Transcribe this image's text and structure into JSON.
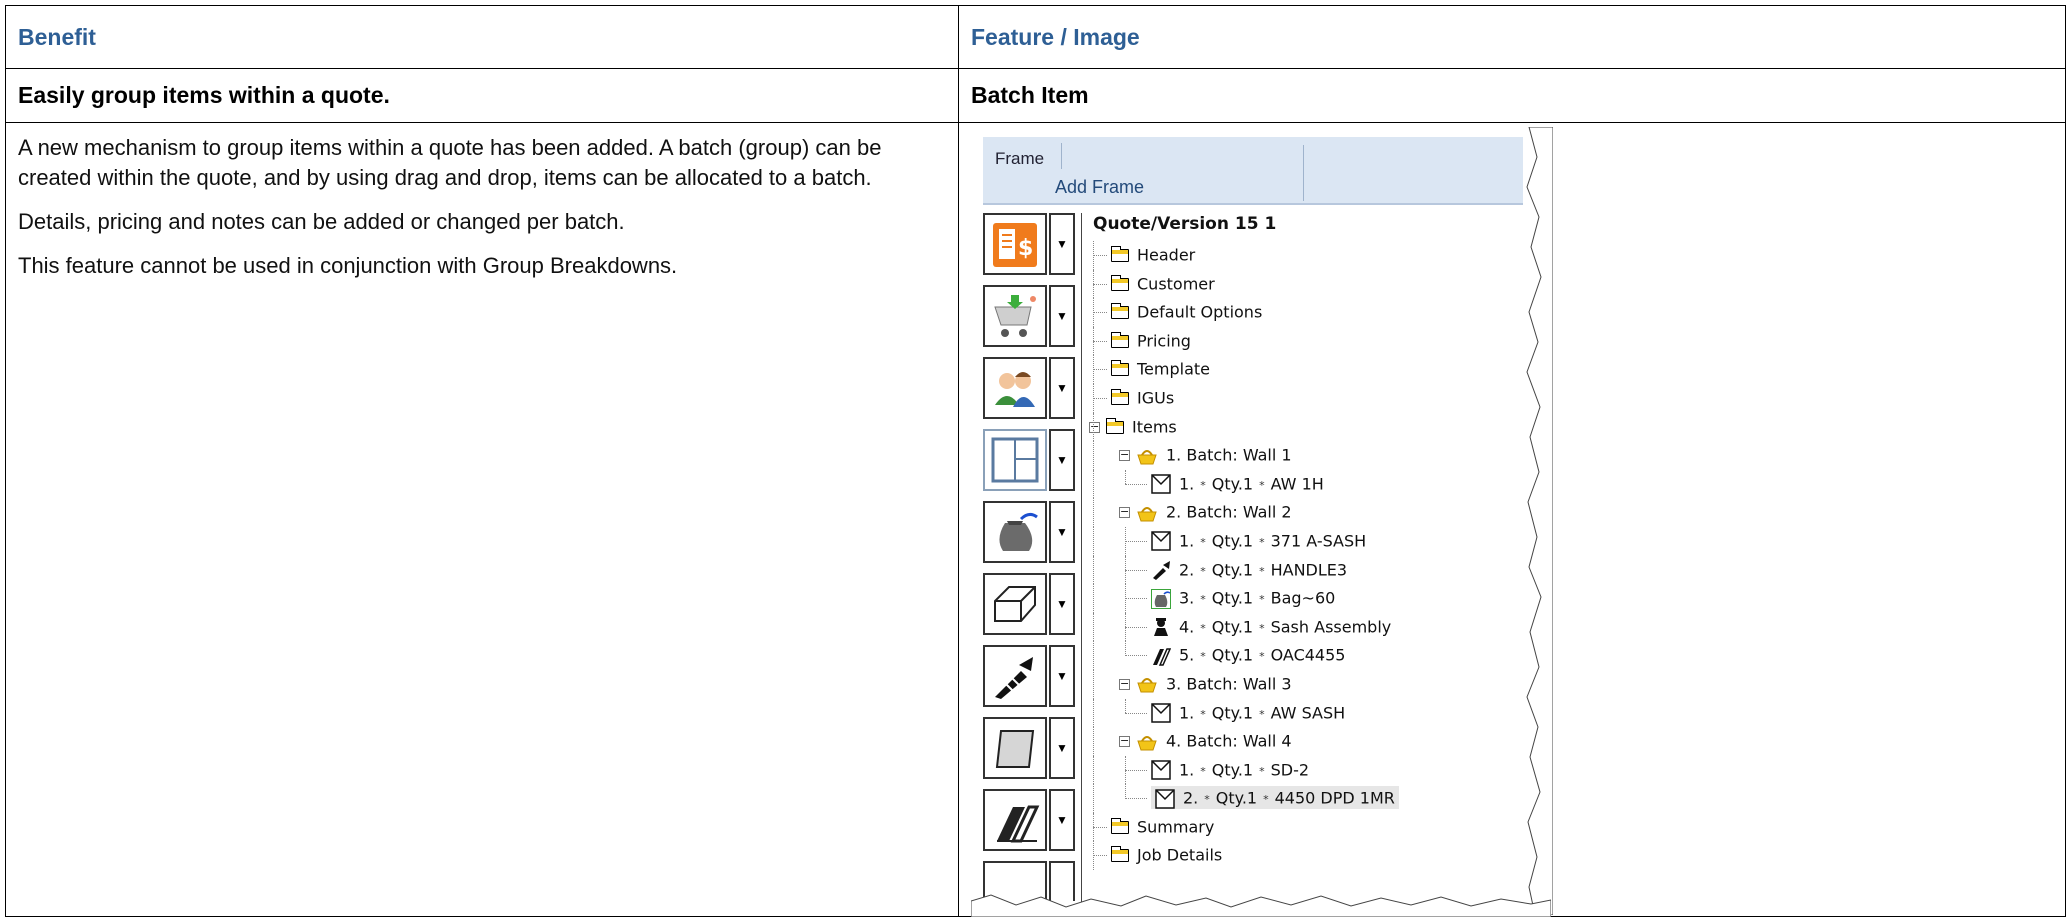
{
  "table": {
    "header_left": "Benefit",
    "header_right": "Feature / Image",
    "benefit_title": "Easily group items within a quote.",
    "feature_title": "Batch Item",
    "paragraphs": [
      "A new mechanism to group items within a quote has been added. A batch (group) can be created within the quote, and by using drag and drop, items can be allocated to a batch.",
      "Details, pricing and notes can be added or changed per batch.",
      "This feature cannot be used in conjunction with Group Breakdowns."
    ]
  },
  "screenshot": {
    "ribbon": {
      "frame_label": "Frame",
      "add_frame_label": "Add Frame"
    },
    "tools": [
      "quote-dollar-icon",
      "cart-icon",
      "users-icon",
      "window-frame-icon",
      "bag-icon",
      "profile-icon",
      "screw-icon",
      "glass-pane-icon",
      "extrusion-icon"
    ],
    "tree": {
      "root": "Quote/Version 15 1",
      "folders_top": [
        "Header",
        "Customer",
        "Default Options",
        "Pricing",
        "Template",
        "IGUs",
        "Items"
      ],
      "batches": [
        {
          "label": "1. Batch: Wall 1",
          "items": [
            {
              "no": "1.",
              "qty": "Qty.1",
              "name": "AW 1H",
              "icon": "frame-icon"
            }
          ]
        },
        {
          "label": "2. Batch: Wall 2",
          "items": [
            {
              "no": "1.",
              "qty": "Qty.1",
              "name": "371 A-SASH",
              "icon": "frame-icon"
            },
            {
              "no": "2.",
              "qty": "Qty.1",
              "name": "HANDLE3",
              "icon": "screw-icon"
            },
            {
              "no": "3.",
              "qty": "Qty.1",
              "name": "Bag~60",
              "icon": "bag-icon"
            },
            {
              "no": "4.",
              "qty": "Qty.1",
              "name": "Sash Assembly",
              "icon": "worker-icon"
            },
            {
              "no": "5.",
              "qty": "Qty.1",
              "name": "OAC4455",
              "icon": "extrusion-icon"
            }
          ]
        },
        {
          "label": "3. Batch: Wall 3",
          "items": [
            {
              "no": "1.",
              "qty": "Qty.1",
              "name": "AW SASH",
              "icon": "frame-icon"
            }
          ]
        },
        {
          "label": "4. Batch: Wall 4",
          "items": [
            {
              "no": "1.",
              "qty": "Qty.1",
              "name": "SD-2",
              "icon": "frame-icon"
            },
            {
              "no": "2.",
              "qty": "Qty.1",
              "name": "4450 DPD 1MR",
              "icon": "frame-icon"
            }
          ]
        }
      ],
      "folders_bottom": [
        "Summary",
        "Job Details"
      ]
    },
    "star": "*"
  }
}
